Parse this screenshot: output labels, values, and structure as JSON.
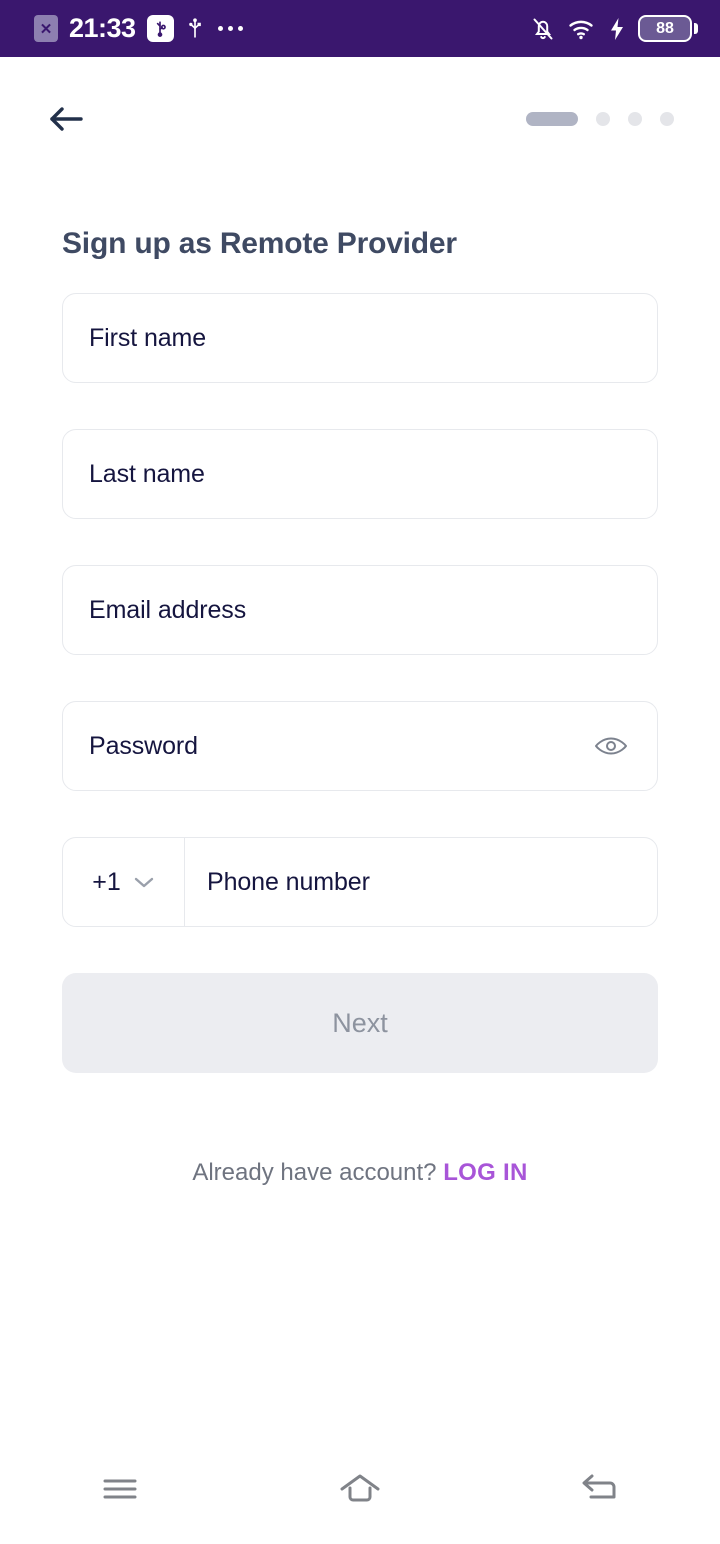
{
  "status_bar": {
    "sim_icon": "sim-x-icon",
    "time": "21:33",
    "usb_debug_icon": "usb-debugging-icon",
    "usb_icon": "usb-icon",
    "more_icon": "more-dots-icon",
    "silent_icon": "bell-slash-icon",
    "wifi_icon": "wifi-icon",
    "charging_icon": "lightning-bolt-icon",
    "battery_level": "88",
    "background_color": "#3a176e"
  },
  "topbar": {
    "back_icon": "arrow-left-icon",
    "stepper": {
      "total_steps": 4,
      "current_step": 1,
      "active_color": "#b0b4c4",
      "inactive_color": "#e4e5e9"
    }
  },
  "page_title": "Sign up as Remote Provider",
  "form": {
    "fields": [
      {
        "name": "first-name",
        "placeholder": "First name",
        "value": ""
      },
      {
        "name": "last-name",
        "placeholder": "Last name",
        "value": ""
      },
      {
        "name": "email-address",
        "placeholder": "Email address",
        "value": ""
      },
      {
        "name": "password",
        "placeholder": "Password",
        "value": "",
        "action_icon": "eye-icon"
      }
    ],
    "phone": {
      "country_code": "+1",
      "chevron_icon": "chevron-down-icon",
      "placeholder": "Phone number",
      "value": ""
    },
    "submit": {
      "label": "Next",
      "enabled": false,
      "background_color": "#ecedf1",
      "text_color": "#8d939f"
    }
  },
  "login": {
    "prompt": "Already have account?",
    "link_label": "LOG IN",
    "link_color": "#a855d8"
  },
  "navbar": {
    "recents_icon": "menu-icon",
    "home_icon": "home-icon",
    "back_icon": "back-arrow-icon",
    "icon_color": "#808389"
  }
}
